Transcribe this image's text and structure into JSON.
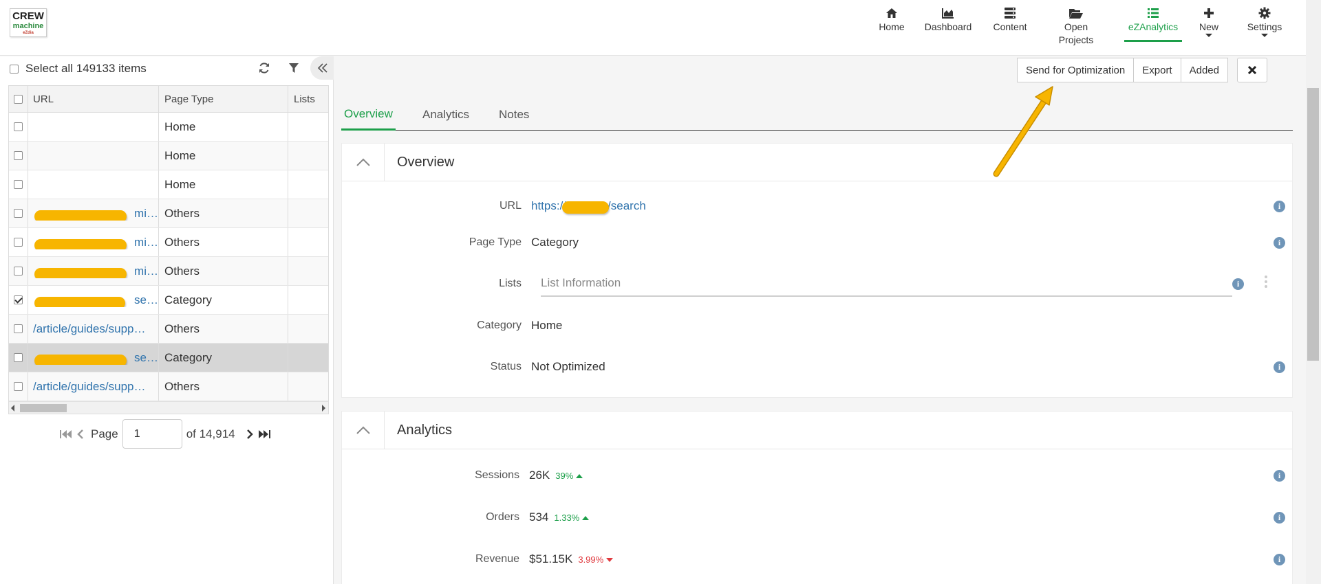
{
  "logo": {
    "line1": "CREW",
    "line2": "machine",
    "line3": "eZdia"
  },
  "nav": [
    {
      "label": "Home",
      "icon": "home-icon"
    },
    {
      "label": "Dashboard",
      "icon": "area-chart-icon"
    },
    {
      "label": "Content",
      "icon": "server-icon"
    },
    {
      "label": "Open Projects",
      "icon": "folder-open-icon"
    },
    {
      "label": "eZAnalytics",
      "icon": "list-icon",
      "active": true
    },
    {
      "label": "New",
      "icon": "plus-icon"
    },
    {
      "label": "Settings",
      "icon": "gear-icon"
    }
  ],
  "left": {
    "select_all": "Select all 149133 items",
    "columns": {
      "url": "URL",
      "page_type": "Page Type",
      "lists": "Lists"
    },
    "rows": [
      {
        "url": "",
        "type": "Home",
        "checked": false
      },
      {
        "url": "",
        "type": "Home",
        "checked": false
      },
      {
        "url": "",
        "type": "Home",
        "checked": false
      },
      {
        "url": "mi…",
        "type": "Others",
        "checked": false
      },
      {
        "url": "mi…",
        "type": "Others",
        "checked": false
      },
      {
        "url": "mi…",
        "type": "Others",
        "checked": false
      },
      {
        "url": "se…",
        "type": "Category",
        "checked": true
      },
      {
        "url": "/article/guides/supp…",
        "type": "Others",
        "checked": false
      },
      {
        "url": "se…",
        "type": "Category",
        "checked": false
      },
      {
        "url": "/article/guides/supp…",
        "type": "Others",
        "checked": false
      }
    ],
    "pager": {
      "label": "Page",
      "value": "1",
      "of": "of 14,914"
    }
  },
  "actions": {
    "send": "Send for Optimization",
    "export": "Export",
    "added": "Added"
  },
  "tabs": {
    "overview": "Overview",
    "analytics": "Analytics",
    "notes": "Notes"
  },
  "overview": {
    "title": "Overview",
    "url_label": "URL",
    "url_prefix": "https://",
    "url_suffix": "/search",
    "page_type_label": "Page Type",
    "page_type": "Category",
    "lists_label": "Lists",
    "lists_placeholder": "List Information",
    "category_label": "Category",
    "category": "Home",
    "status_label": "Status",
    "status": "Not Optimized"
  },
  "analytics": {
    "title": "Analytics",
    "sessions_label": "Sessions",
    "sessions": "26K",
    "sessions_delta": "39%",
    "orders_label": "Orders",
    "orders": "534",
    "orders_delta": "1.33%",
    "revenue_label": "Revenue",
    "revenue": "$51.15K",
    "revenue_delta": "3.99%"
  },
  "colors": {
    "accent": "#1d9f4a",
    "link": "#3174ad",
    "negative": "#e0393e",
    "highlight": "#f7b500"
  }
}
